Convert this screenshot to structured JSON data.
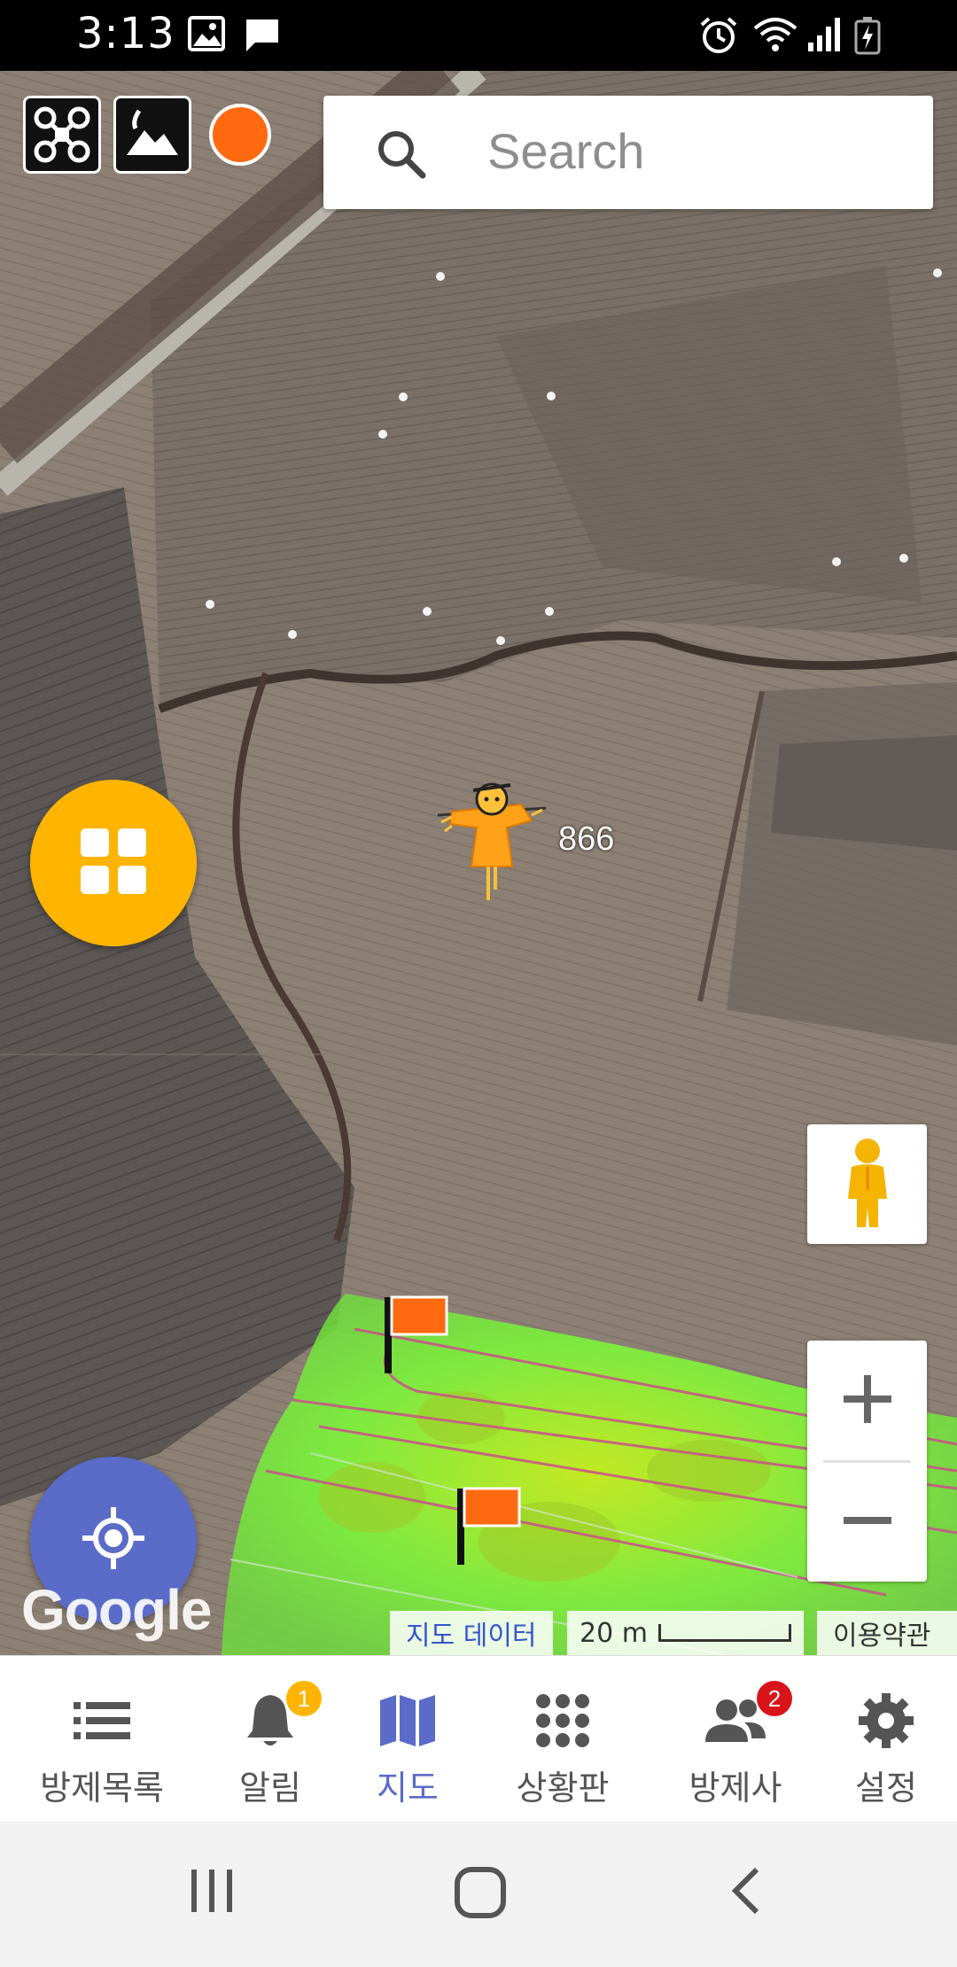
{
  "status_bar": {
    "time": "3:13",
    "left_icons": [
      "image-icon",
      "message-icon"
    ],
    "right_icons": [
      "alarm-icon",
      "wifi-icon",
      "signal-icon",
      "battery-charging-icon"
    ]
  },
  "map": {
    "search": {
      "placeholder": "Search"
    },
    "top_icons": [
      "drone-icon",
      "terrain-icon",
      "record-dot"
    ],
    "marker_label": "866",
    "google_logo": "Google",
    "attribution": {
      "map_data": "지도 데이터",
      "scale": "20 m",
      "terms": "이용약관"
    },
    "heatmap_color": "#7cf23c",
    "accent_orange": "#ff6a10"
  },
  "bottom_nav": {
    "items": [
      {
        "label": "방제목록",
        "icon": "list-icon",
        "active": false
      },
      {
        "label": "알림",
        "icon": "bell-icon",
        "badge": "1",
        "active": false
      },
      {
        "label": "지도",
        "icon": "map-icon",
        "active": true
      },
      {
        "label": "상황판",
        "icon": "dots-grid-icon",
        "active": false
      },
      {
        "label": "방제사",
        "icon": "people-icon",
        "badge": "2",
        "active": false
      },
      {
        "label": "설정",
        "icon": "gear-icon",
        "active": false
      }
    ]
  },
  "colors": {
    "accent": "#5b6bc8",
    "fab_yellow": "#ffb400",
    "badge_red": "#d8141a"
  }
}
